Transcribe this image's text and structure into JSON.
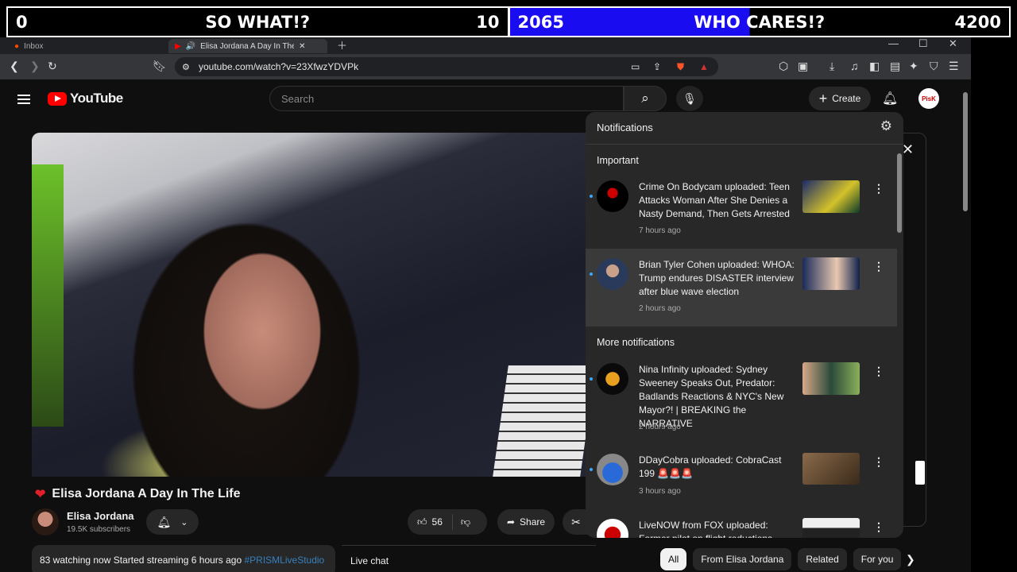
{
  "scoreboard": {
    "left_score": "0",
    "left_label": "SO WHAT!?",
    "left_count": "10",
    "right_score": "2065",
    "right_label": "WHO CARES!?",
    "right_count": "4200",
    "right_fill_fraction": 0.48,
    "right_fill_color": "#1a0cf0"
  },
  "browser": {
    "tabs": [
      {
        "title": "Inbox",
        "icon": "reddit-icon"
      },
      {
        "title": "Elisa Jordana A Day In The",
        "icon": "youtube-icon"
      }
    ],
    "url": "youtube.com/watch?v=23XfwzYDVPk"
  },
  "youtube": {
    "logo_text": "YouTube",
    "search_placeholder": "Search",
    "create_label": "Create",
    "avatar_text": "PisK",
    "video": {
      "title": "Elisa Jordana A Day In The Life",
      "channel": "Elisa Jordana",
      "subscribers": "19.5K subscribers",
      "likes": "56",
      "share_label": "Share",
      "description": "83 watching now  Started streaming 6 hours ago",
      "hashtag": "#PRISMLiveStudio"
    },
    "live_chat_label": "Live chat",
    "chips": [
      "All",
      "From Elisa Jordana",
      "Related",
      "For you"
    ]
  },
  "notifications": {
    "title": "Notifications",
    "important_label": "Important",
    "more_label": "More notifications",
    "items": [
      {
        "text": "Crime On Bodycam uploaded: Teen Attacks Woman After She Denies a Nasty Demand, Then Gets Arrested",
        "time": "7 hours ago"
      },
      {
        "text": "Brian Tyler Cohen uploaded: WHOA: Trump endures DISASTER interview after blue wave election",
        "time": "2 hours ago"
      },
      {
        "text": "Nina Infinity uploaded: Sydney Sweeney Speaks Out, Predator: Badlands Reactions & NYC's New Mayor?! | BREAKING the NARRATIVE",
        "time": "2 hours ago"
      },
      {
        "text": "DDayCobra uploaded: CobraCast 199 🚨🚨🚨",
        "time": "3 hours ago"
      },
      {
        "text": "LiveNOW from FOX uploaded: Former pilot on flight reductions",
        "time": ""
      }
    ]
  },
  "colors": {
    "accent_red": "#ff0000",
    "page_bg": "#0f0f0f",
    "popup_bg": "#282828",
    "link_blue": "#3ea6ff"
  }
}
